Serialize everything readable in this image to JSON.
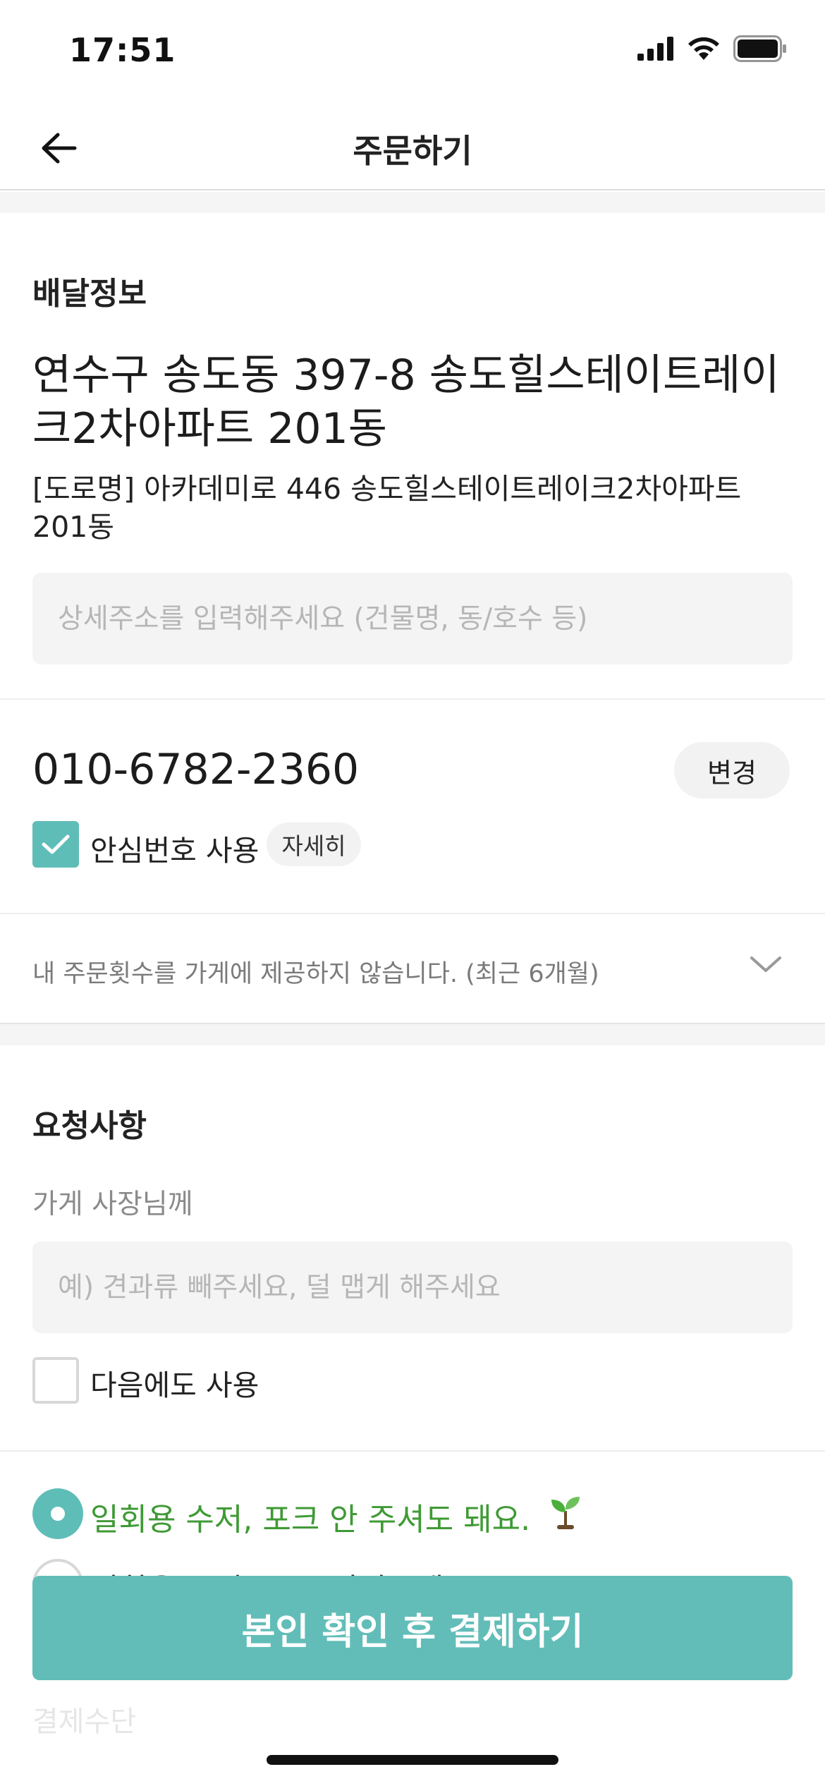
{
  "status_bar": {
    "time": "17:51"
  },
  "nav": {
    "title": "주문하기"
  },
  "delivery": {
    "heading": "배달정보",
    "address_main": "연수구 송도동 397-8 송도힐스테이트레이크2차아파트 201동",
    "address_road": "[도로명] 아카데미로 446 송도힐스테이트레이크2차아파트 201동",
    "detail_placeholder": "상세주소를 입력해주세요 (건물명, 동/호수 등)",
    "phone": "010-6782-2360",
    "change_label": "변경",
    "safe_number_label": "안심번호 사용",
    "safe_number_checked": true,
    "detail_chip": "자세히",
    "privacy_text": "내 주문횟수를 가게에 제공하지 않습니다. (최근 6개월)"
  },
  "request": {
    "heading": "요청사항",
    "owner_label": "가게 사장님께",
    "owner_placeholder": "예) 견과류 빼주세요, 덜 맵게 해주세요",
    "reuse_label": "다음에도 사용",
    "reuse_checked": false
  },
  "cutlery": {
    "options": [
      {
        "label": "일회용 수저, 포크 안 주셔도 돼요.",
        "selected": true
      },
      {
        "label": "일회용 수저, 포크 넣어주세요",
        "selected": false
      }
    ]
  },
  "hidden_next": "결제수단",
  "footer": {
    "pay_button": "본인 확인 후 결제하기"
  },
  "colors": {
    "accent": "#5fbdb8",
    "green_text": "#3f9a35"
  }
}
